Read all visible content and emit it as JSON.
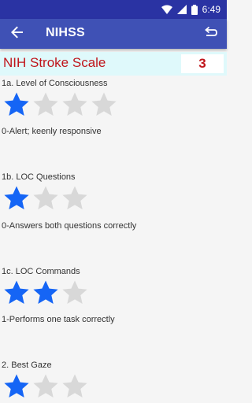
{
  "status_bar": {
    "time": "6:49",
    "icons": [
      "wifi-icon",
      "signal-icon",
      "battery-icon"
    ]
  },
  "app_bar": {
    "title": "NIHSS",
    "back_icon": "back-arrow-icon",
    "undo_icon": "undo-icon"
  },
  "header": {
    "title": "NIH Stroke Scale",
    "score": "3"
  },
  "colors": {
    "primary": "#3f51b5",
    "status_bar": "#2a33a3",
    "accent_red": "#c0151b",
    "header_bg": "#dff9fb",
    "star_filled": "#1565f5",
    "star_empty": "#d8d8d8"
  },
  "items": [
    {
      "label": "1a. Level of Consciousness",
      "max_stars": 4,
      "rating": 1,
      "description": "0-Alert; keenly responsive"
    },
    {
      "label": "1b. LOC Questions",
      "max_stars": 3,
      "rating": 1,
      "description": "0-Answers both questions correctly"
    },
    {
      "label": "1c. LOC Commands",
      "max_stars": 3,
      "rating": 2,
      "description": "1-Performs one task correctly"
    },
    {
      "label": "2. Best Gaze",
      "max_stars": 3,
      "rating": 1,
      "description": ""
    }
  ]
}
